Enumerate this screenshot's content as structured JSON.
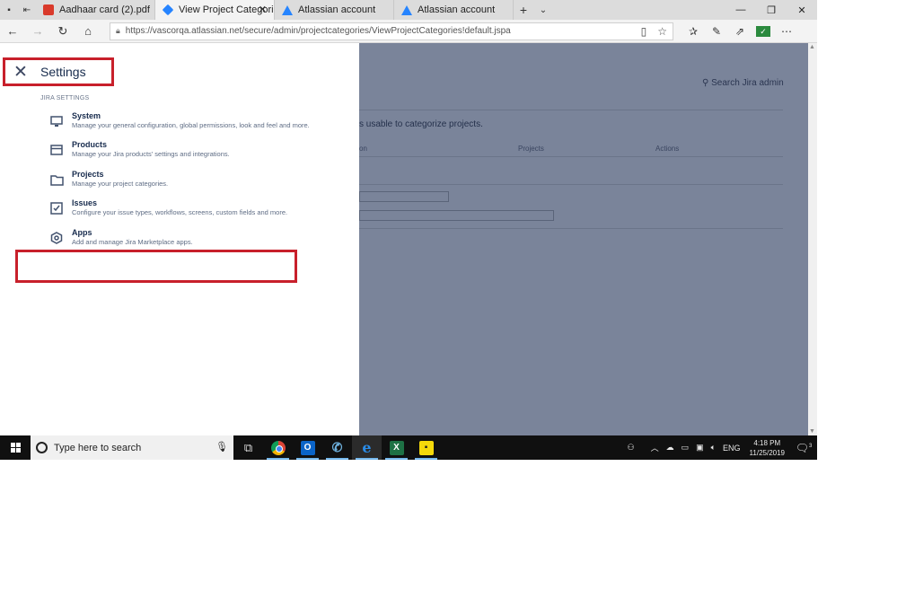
{
  "tabs": [
    {
      "label": "Aadhaar card (2).pdf",
      "icon": "pdf-icon",
      "active": false
    },
    {
      "label": "View Project Categories",
      "icon": "jira-icon",
      "active": true
    },
    {
      "label": "Atlassian account",
      "icon": "atlassian-icon",
      "active": false
    },
    {
      "label": "Atlassian account",
      "icon": "atlassian-icon",
      "active": false
    }
  ],
  "address": {
    "url": "https://vascorqa.atlassian.net/secure/admin/projectcategories/ViewProjectCategories!default.jspa"
  },
  "settings": {
    "title": "Settings",
    "section_label": "JIRA SETTINGS",
    "items": [
      {
        "title": "System",
        "description": "Manage your general configuration, global permissions, look and feel and more.",
        "icon": "monitor-icon"
      },
      {
        "title": "Products",
        "description": "Manage your Jira products' settings and integrations.",
        "icon": "products-icon"
      },
      {
        "title": "Projects",
        "description": "Manage your project categories.",
        "icon": "folder-icon"
      },
      {
        "title": "Issues",
        "description": "Configure your issue types, workflows, screens, custom fields and more.",
        "icon": "issues-icon"
      },
      {
        "title": "Apps",
        "description": "Add and manage Jira Marketplace apps.",
        "icon": "apps-icon"
      }
    ]
  },
  "background_page": {
    "search_label": "Search Jira admin",
    "description_fragment": "s usable to categorize projects.",
    "columns": [
      "on",
      "Projects",
      "Actions"
    ]
  },
  "taskbar": {
    "search_placeholder": "Type here to search",
    "language": "ENG",
    "time": "4:18 PM",
    "date": "11/25/2019",
    "notification_count": "3"
  },
  "colors": {
    "overlay": "#7a849a",
    "highlight_red": "#c8202b",
    "taskbar": "#101010"
  }
}
